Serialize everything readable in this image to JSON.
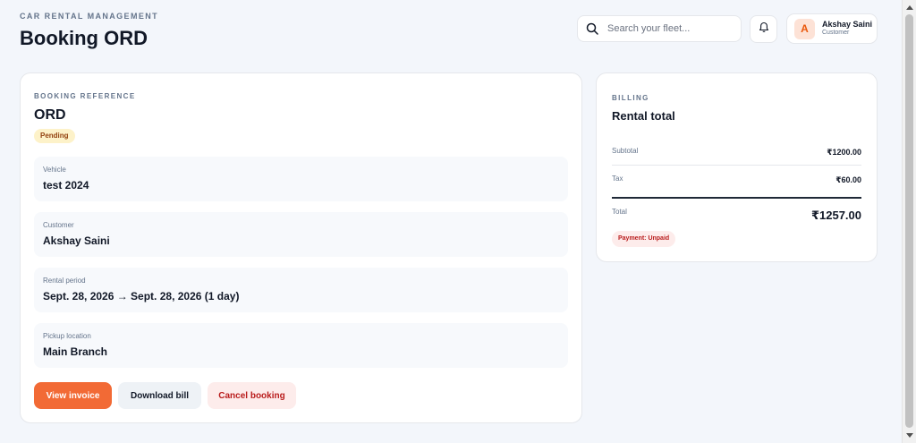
{
  "header": {
    "app_label": "CAR RENTAL MANAGEMENT",
    "page_title": "Booking ORD",
    "search_placeholder": "Search your fleet...",
    "user": {
      "initial": "A",
      "name": "Akshay Saini",
      "role": "Customer"
    }
  },
  "booking": {
    "section_label": "BOOKING REFERENCE",
    "reference": "ORD",
    "status": "Pending",
    "fields": [
      {
        "label": "Vehicle",
        "value": "test 2024"
      },
      {
        "label": "Customer",
        "value": "Akshay Saini"
      },
      {
        "label": "Rental period",
        "value": "Sept. 28, 2026 → Sept. 28, 2026 (1 day)"
      },
      {
        "label": "Pickup location",
        "value": "Main Branch"
      }
    ],
    "actions": {
      "view_invoice": "View invoice",
      "download_bill": "Download bill",
      "cancel_booking": "Cancel booking"
    }
  },
  "billing": {
    "section_label": "BILLING",
    "title": "Rental total",
    "subtotal_label": "Subtotal",
    "subtotal_value": "₹1200.00",
    "tax_label": "Tax",
    "tax_value": "₹60.00",
    "total_label": "Total",
    "total_value": "₹1257.00",
    "payment_status": "Payment: Unpaid"
  },
  "colors": {
    "accent": "#f26a35",
    "background": "#f3f6fb",
    "pending_badge": "#fdf2c9",
    "unpaid_badge": "#fdeceb"
  }
}
